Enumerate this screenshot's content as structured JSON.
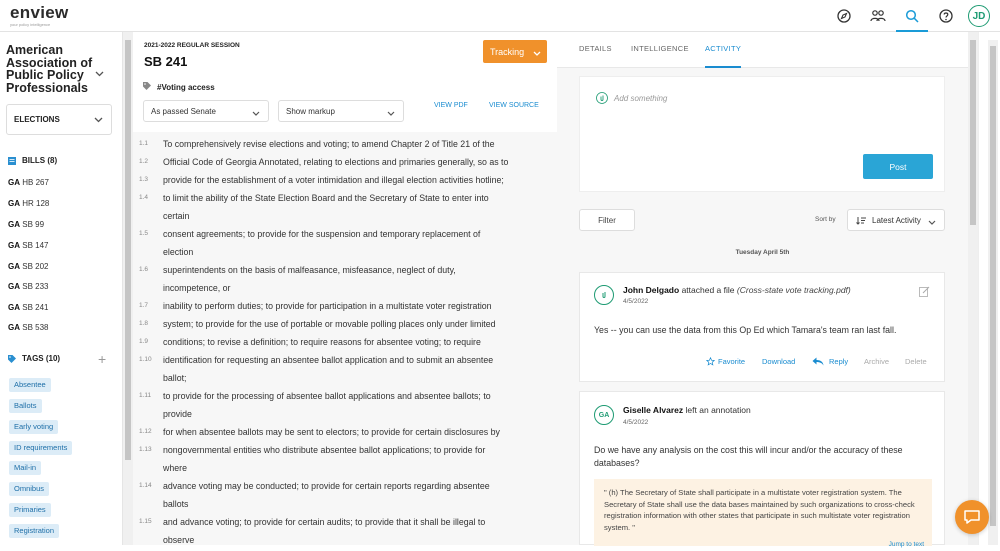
{
  "brand": {
    "name": "enview",
    "tagline": "your policy intelligence"
  },
  "topnav": {
    "avatar_initials": "JD",
    "icons": [
      "compass-icon",
      "people-icon",
      "search-icon",
      "help-icon"
    ]
  },
  "sidebar": {
    "org": "American Association of Public Policy Professionals",
    "elections_label": "ELECTIONS",
    "bills_header": "BILLS (8)",
    "bills": [
      {
        "state": "GA",
        "id": "HB 267"
      },
      {
        "state": "GA",
        "id": "HR 128"
      },
      {
        "state": "GA",
        "id": "SB 99"
      },
      {
        "state": "GA",
        "id": "SB 147"
      },
      {
        "state": "GA",
        "id": "SB 202"
      },
      {
        "state": "GA",
        "id": "SB 233"
      },
      {
        "state": "GA",
        "id": "SB 241"
      },
      {
        "state": "GA",
        "id": "SB 538"
      }
    ],
    "tags_header": "TAGS (10)",
    "tags": [
      "Absentee",
      "Ballots",
      "Early voting",
      "ID requirements",
      "Mail-in",
      "Omnibus",
      "Primaries",
      "Registration"
    ]
  },
  "doc": {
    "session": "2021-2022 REGULAR SESSION",
    "bill": "SB 241",
    "tracking": "Tracking",
    "tag": "#Voting access",
    "version": "As passed Senate",
    "markup": "Show markup",
    "view_pdf": "VIEW PDF",
    "view_source": "VIEW SOURCE",
    "lines": [
      {
        "no": "1.1",
        "text": "To comprehensively revise elections and voting; to amend Chapter 2 of Title 21 of the"
      },
      {
        "no": "1.2",
        "text": "Official Code of Georgia Annotated, relating to elections and primaries generally, so as to"
      },
      {
        "no": "1.3",
        "text": "provide for the establishment of a voter intimidation and illegal election activities hotline;"
      },
      {
        "no": "1.4",
        "text": "to limit the ability of the State Election Board and the Secretary of State to enter into"
      },
      {
        "no": "",
        "text": "certain"
      },
      {
        "no": "1.5",
        "text": "consent agreements; to provide for the suspension and temporary replacement of"
      },
      {
        "no": "",
        "text": "election"
      },
      {
        "no": "1.6",
        "text": "superintendents on the basis of malfeasance, misfeasance, neglect of duty,"
      },
      {
        "no": "",
        "text": "incompetence, or"
      },
      {
        "no": "1.7",
        "text": "inability to perform duties; to provide for participation in a multistate voter registration"
      },
      {
        "no": "1.8",
        "text": "system; to provide for the use of portable or movable polling places only under limited"
      },
      {
        "no": "1.9",
        "text": "conditions; to revise a definition; to require reasons for absentee voting; to require"
      },
      {
        "no": "1.10",
        "text": "identification for requesting an absentee ballot application and to submit an absentee"
      },
      {
        "no": "",
        "text": "ballot;"
      },
      {
        "no": "1.11",
        "text": "to provide for the processing of absentee ballot applications and absentee ballots; to"
      },
      {
        "no": "",
        "text": "provide"
      },
      {
        "no": "1.12",
        "text": "for when absentee ballots may be sent to electors; to provide for certain disclosures by"
      },
      {
        "no": "1.13",
        "text": "nongovernmental entities who distribute absentee ballot applications; to provide for"
      },
      {
        "no": "",
        "text": "where"
      },
      {
        "no": "1.14",
        "text": "advance voting may be conducted; to provide for certain reports regarding absentee"
      },
      {
        "no": "",
        "text": "ballots"
      },
      {
        "no": "1.15",
        "text": "and advance voting; to provide for certain audits; to provide that it shall be illegal to"
      },
      {
        "no": "",
        "text": "observe"
      }
    ]
  },
  "panel": {
    "tabs": [
      "DETAILS",
      "INTELLIGENCE",
      "ACTIVITY"
    ],
    "add_placeholder": "Add something",
    "post": "Post",
    "filter": "Filter",
    "sort_by": "Sort by",
    "sort_value": "Latest Activity",
    "day": "Tuesday April 5th",
    "card1": {
      "name": "John Delgado",
      "action": "attached a file",
      "file": "(Cross-state vote tracking.pdf)",
      "date": "4/5/2022",
      "message": "Yes -- you can use the data from this Op Ed which Tamara's team ran last fall.",
      "favorite": "Favorite",
      "download": "Download",
      "reply": "Reply",
      "archive": "Archive",
      "delete": "Delete"
    },
    "card2": {
      "initials": "GA",
      "name": "Giselle Alvarez",
      "action": "left an annotation",
      "date": "4/5/2022",
      "message": "Do we have any analysis on the cost this will incur and/or the accuracy of these databases?",
      "quote": "\" (h) The Secretary of State shall participate in a multistate voter registration system. The Secretary of State shall use the data bases maintained by such organizations to cross-check registration information with other states that participate in such multistate voter registration system. \"",
      "jump": "Jump to text"
    }
  },
  "colors": {
    "accent": "#1a8cd0",
    "tracking": "#f0912b",
    "avatar": "#1e9b73"
  }
}
